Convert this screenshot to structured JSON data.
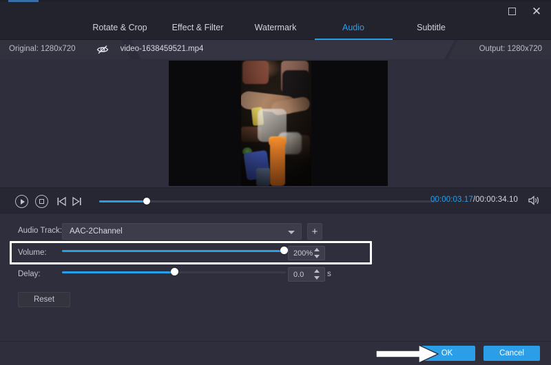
{
  "window": {
    "maximize_icon": "maximize-icon",
    "close_icon": "close-icon"
  },
  "tabs": [
    {
      "label": "Rotate & Crop",
      "active": false
    },
    {
      "label": "Effect & Filter",
      "active": false
    },
    {
      "label": "Watermark",
      "active": false
    },
    {
      "label": "Audio",
      "active": true
    },
    {
      "label": "Subtitle",
      "active": false
    }
  ],
  "infobar": {
    "original_label": "Original: 1280x720",
    "eye_icon": "eye-hidden-icon",
    "file_name": "video-1638459521.mp4",
    "output_label": "Output: 1280x720"
  },
  "player": {
    "play_icon": "play-icon",
    "stop_icon": "stop-icon",
    "prev_frame_icon": "previous-frame-icon",
    "next_frame_icon": "next-frame-icon",
    "seek_percent": 14,
    "current_time": "00:00:03.17",
    "total_time": "/00:00:34.10",
    "volume_icon": "speaker-icon",
    "accent_color": "#2b9ee8"
  },
  "audio_settings": {
    "track_label": "Audio Track:",
    "track_value": "AAC-2Channel",
    "add_track_label": "+",
    "volume_label": "Volume:",
    "volume_value": "200%",
    "volume_percent": 100,
    "delay_label": "Delay:",
    "delay_value": "0.0",
    "delay_unit": "s",
    "delay_percent": 50,
    "reset_label": "Reset"
  },
  "footer": {
    "ok_label": "OK",
    "cancel_label": "Cancel",
    "arrow_annotation": "arrow-annotation-icon"
  }
}
